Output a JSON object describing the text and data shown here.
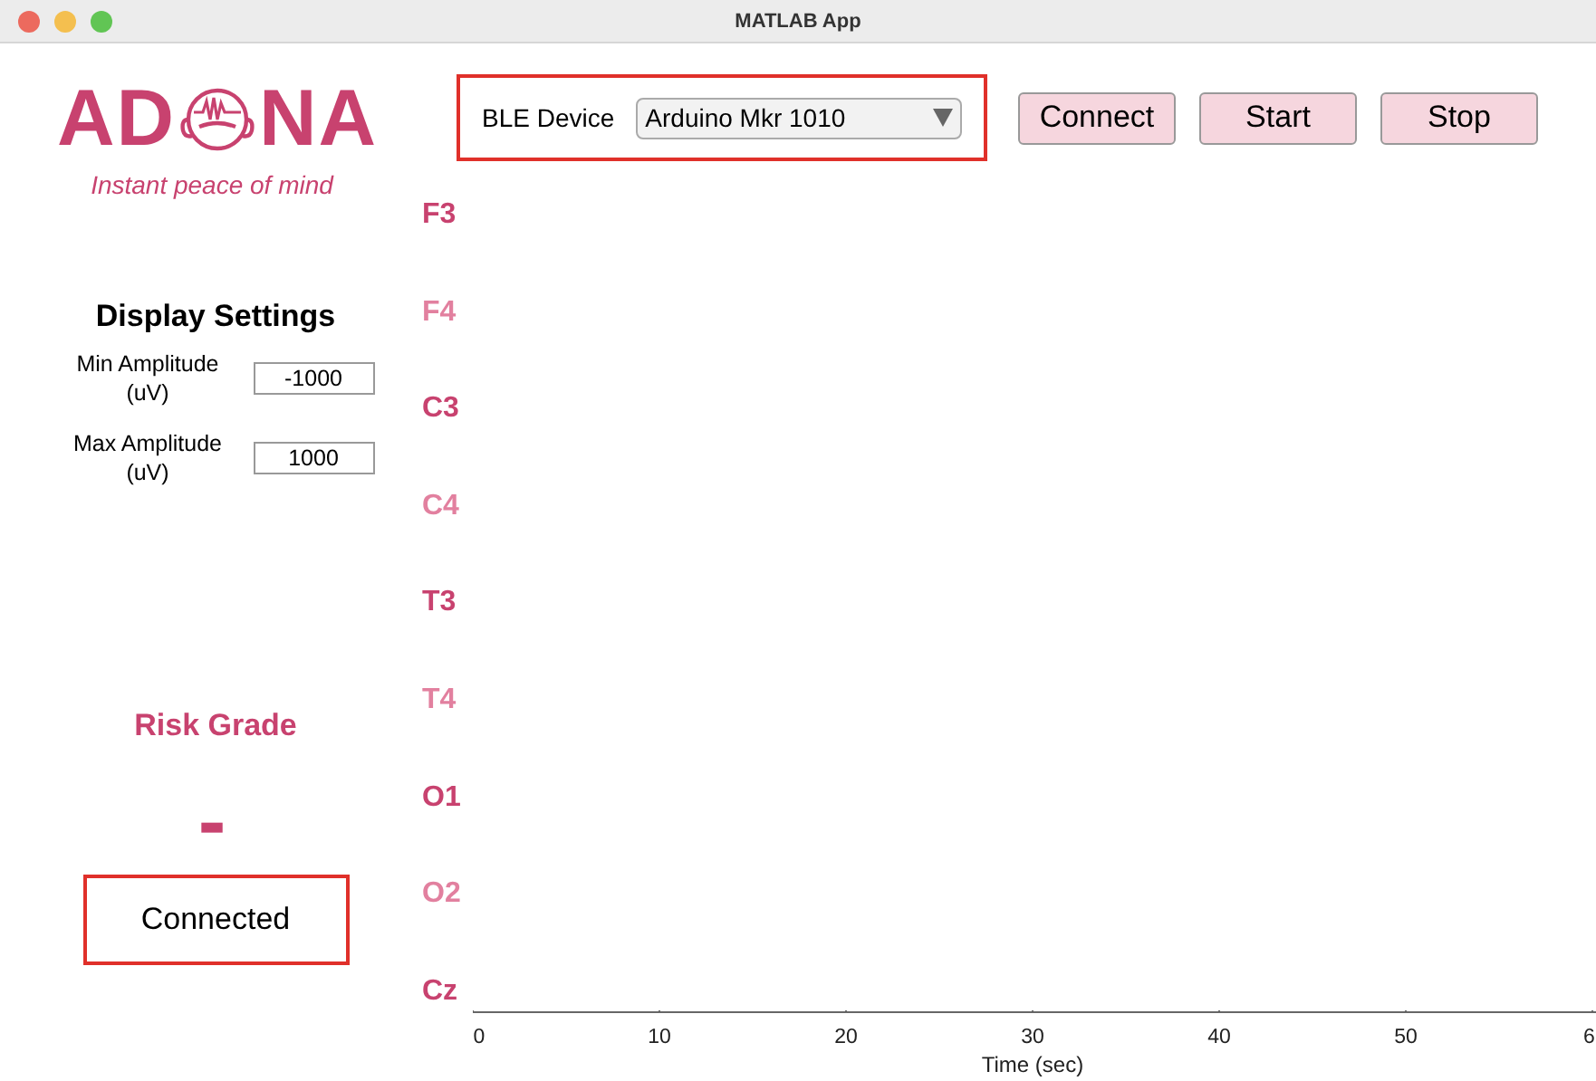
{
  "window": {
    "title": "MATLAB App"
  },
  "logo": {
    "text_before": "AD",
    "text_after": "NA",
    "tagline": "Instant peace of mind"
  },
  "display_settings": {
    "title": "Display Settings",
    "fields": [
      {
        "label": "Min Amplitude (uV)",
        "value": "-1000"
      },
      {
        "label": "Max Amplitude (uV)",
        "value": "1000"
      }
    ]
  },
  "risk": {
    "title": "Risk Grade",
    "value": "-"
  },
  "status": {
    "text": "Connected"
  },
  "device": {
    "label": "BLE Device",
    "value": "Arduino Mkr 1010"
  },
  "buttons": [
    "Connect",
    "Start",
    "Stop"
  ],
  "plot": {
    "channels": [
      {
        "name": "F3",
        "color": "#c8426f"
      },
      {
        "name": "F4",
        "color": "#e2809f"
      },
      {
        "name": "C3",
        "color": "#c8426f"
      },
      {
        "name": "C4",
        "color": "#e2809f"
      },
      {
        "name": "T3",
        "color": "#c8426f"
      },
      {
        "name": "T4",
        "color": "#e2809f"
      },
      {
        "name": "O1",
        "color": "#c8426f"
      },
      {
        "name": "O2",
        "color": "#e2809f"
      },
      {
        "name": "Cz",
        "color": "#c8426f"
      }
    ],
    "x_axis": {
      "ticks": [
        "0",
        "10",
        "20",
        "30",
        "40",
        "50",
        "6"
      ],
      "label": "Time (sec)"
    }
  }
}
